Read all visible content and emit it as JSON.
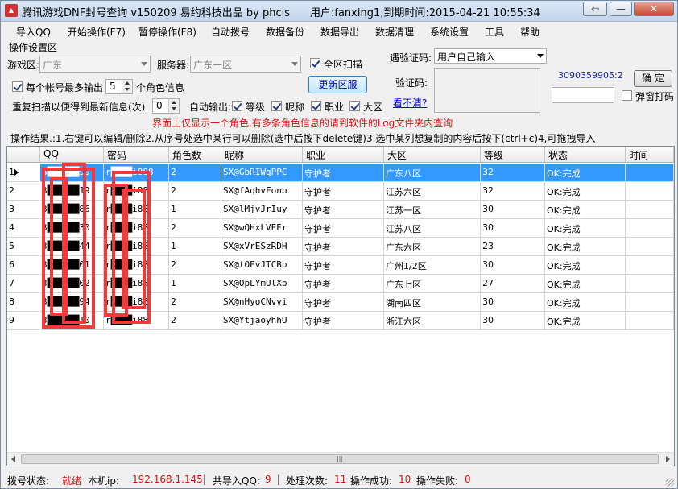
{
  "window": {
    "title": "腾讯游戏DNF封号查询 v150209   易约科技出品  by phcis",
    "user_info": "用户:fanxing1,到期时间:2015-04-21 10:55:34",
    "back_label": "⇦",
    "min_label": "—",
    "close_label": "✕"
  },
  "menu": [
    "导入QQ",
    "开始操作(F7)",
    "暂停操作(F8)",
    "自动拨号",
    "数据备份",
    "数据导出",
    "数据清理",
    "系统设置",
    "工具",
    "帮助"
  ],
  "settings": {
    "group_label": "操作设置区",
    "game_area_label": "游戏区:",
    "game_area_value": "广东",
    "server_label": "服务器:",
    "server_value": "广东一区",
    "all_scan_label": "全区扫描",
    "all_scan_checked": true,
    "max_output_prefix": "每个帐号最多输出",
    "max_output_checked": true,
    "max_output_value": "5",
    "max_output_suffix": "个角色信息",
    "rescan_label": "重复扫描以便得到最新信息(次)",
    "rescan_value": "0",
    "auto_output_label": "自动输出:",
    "auto_level_label": "等级",
    "auto_nick_label": "昵称",
    "auto_job_label": "职业",
    "auto_area_label": "大区",
    "update_server_label": "更新区服",
    "captcha_mode_label": "遇验证码:",
    "captcha_mode_value": "用户自己输入",
    "captcha_label": "验证码:",
    "captcha_unclear": "看不清?",
    "captcha_code": "3090359905:2",
    "confirm_label": "确 定",
    "popup_code_label": "弹窗打码",
    "popup_code_checked": false,
    "warning": "界面上仅显示一个角色,有多条角色信息的请到软件的Log文件夹内查询",
    "result_hint": "操作结果.:1.右键可以编辑/删除2.从序号处选中某行可以删除(选中后按下delete键)3.选中某列想复制的内容后按下(ctrl+c)4,可拖拽导入"
  },
  "table": {
    "headers": [
      "",
      "QQ",
      "密码",
      "角色数",
      "昵称",
      "职业",
      "大区",
      "等级",
      "状态",
      "时间"
    ],
    "rows": [
      {
        "no": "1",
        "qq": "3██████99",
        "pwd": "r████i888",
        "roles": "2",
        "nick": "SX@GbRIWgPPC",
        "job": "守护者",
        "area": "广东八区",
        "level": "32",
        "status": "OK:完成",
        "time": ""
      },
      {
        "no": "2",
        "qq": "3██████19",
        "pwd": "r████i88",
        "roles": "2",
        "nick": "SX@fAqhvFonb",
        "job": "守护者",
        "area": "江苏六区",
        "level": "32",
        "status": "OK:完成",
        "time": ""
      },
      {
        "no": "3",
        "qq": "3██████86",
        "pwd": "r████i88",
        "roles": "1",
        "nick": "SX@lMjvJrIuy",
        "job": "守护者",
        "area": "江苏一区",
        "level": "30",
        "status": "OK:完成",
        "time": ""
      },
      {
        "no": "4",
        "qq": "3██████30",
        "pwd": "r████i88",
        "roles": "2",
        "nick": "SX@wQHxLVEEr",
        "job": "守护者",
        "area": "江苏八区",
        "level": "30",
        "status": "OK:完成",
        "time": ""
      },
      {
        "no": "5",
        "qq": "3██████44",
        "pwd": "r████i88",
        "roles": "1",
        "nick": "SX@xVrESzRDH",
        "job": "守护者",
        "area": "广东六区",
        "level": "23",
        "status": "OK:完成",
        "time": ""
      },
      {
        "no": "6",
        "qq": "3██████01",
        "pwd": "r████i88",
        "roles": "2",
        "nick": "SX@tOEvJTCBp",
        "job": "守护者",
        "area": "广州1/2区",
        "level": "30",
        "status": "OK:完成",
        "time": ""
      },
      {
        "no": "7",
        "qq": "3██████02",
        "pwd": "r████i88",
        "roles": "1",
        "nick": "SX@OpLYmUlXb",
        "job": "守护者",
        "area": "广东七区",
        "level": "27",
        "status": "OK:完成",
        "time": ""
      },
      {
        "no": "8",
        "qq": "3██████94",
        "pwd": "r████i88",
        "roles": "2",
        "nick": "SX@nHyoCNvvi",
        "job": "守护者",
        "area": "湖南四区",
        "level": "30",
        "status": "OK:完成",
        "time": ""
      },
      {
        "no": "9",
        "qq": "3██████10",
        "pwd": "r████i88",
        "roles": "2",
        "nick": "SX@YtjaoyhhU",
        "job": "守护者",
        "area": "浙江六区",
        "level": "30",
        "status": "OK:完成",
        "time": ""
      }
    ],
    "scroll_thumb": "|||"
  },
  "status": {
    "dial_label": "拨号状态:",
    "dial_value": "就绪",
    "ip_label": "本机ip:",
    "ip_value": "192.168.1.145",
    "sep": "|",
    "imported_label": "共导入QQ:",
    "imported_value": "9",
    "processed_label": "处理次数:",
    "processed_value": "11",
    "success_label": "操作成功:",
    "success_value": "10",
    "fail_label": "操作失败:",
    "fail_value": "0"
  }
}
